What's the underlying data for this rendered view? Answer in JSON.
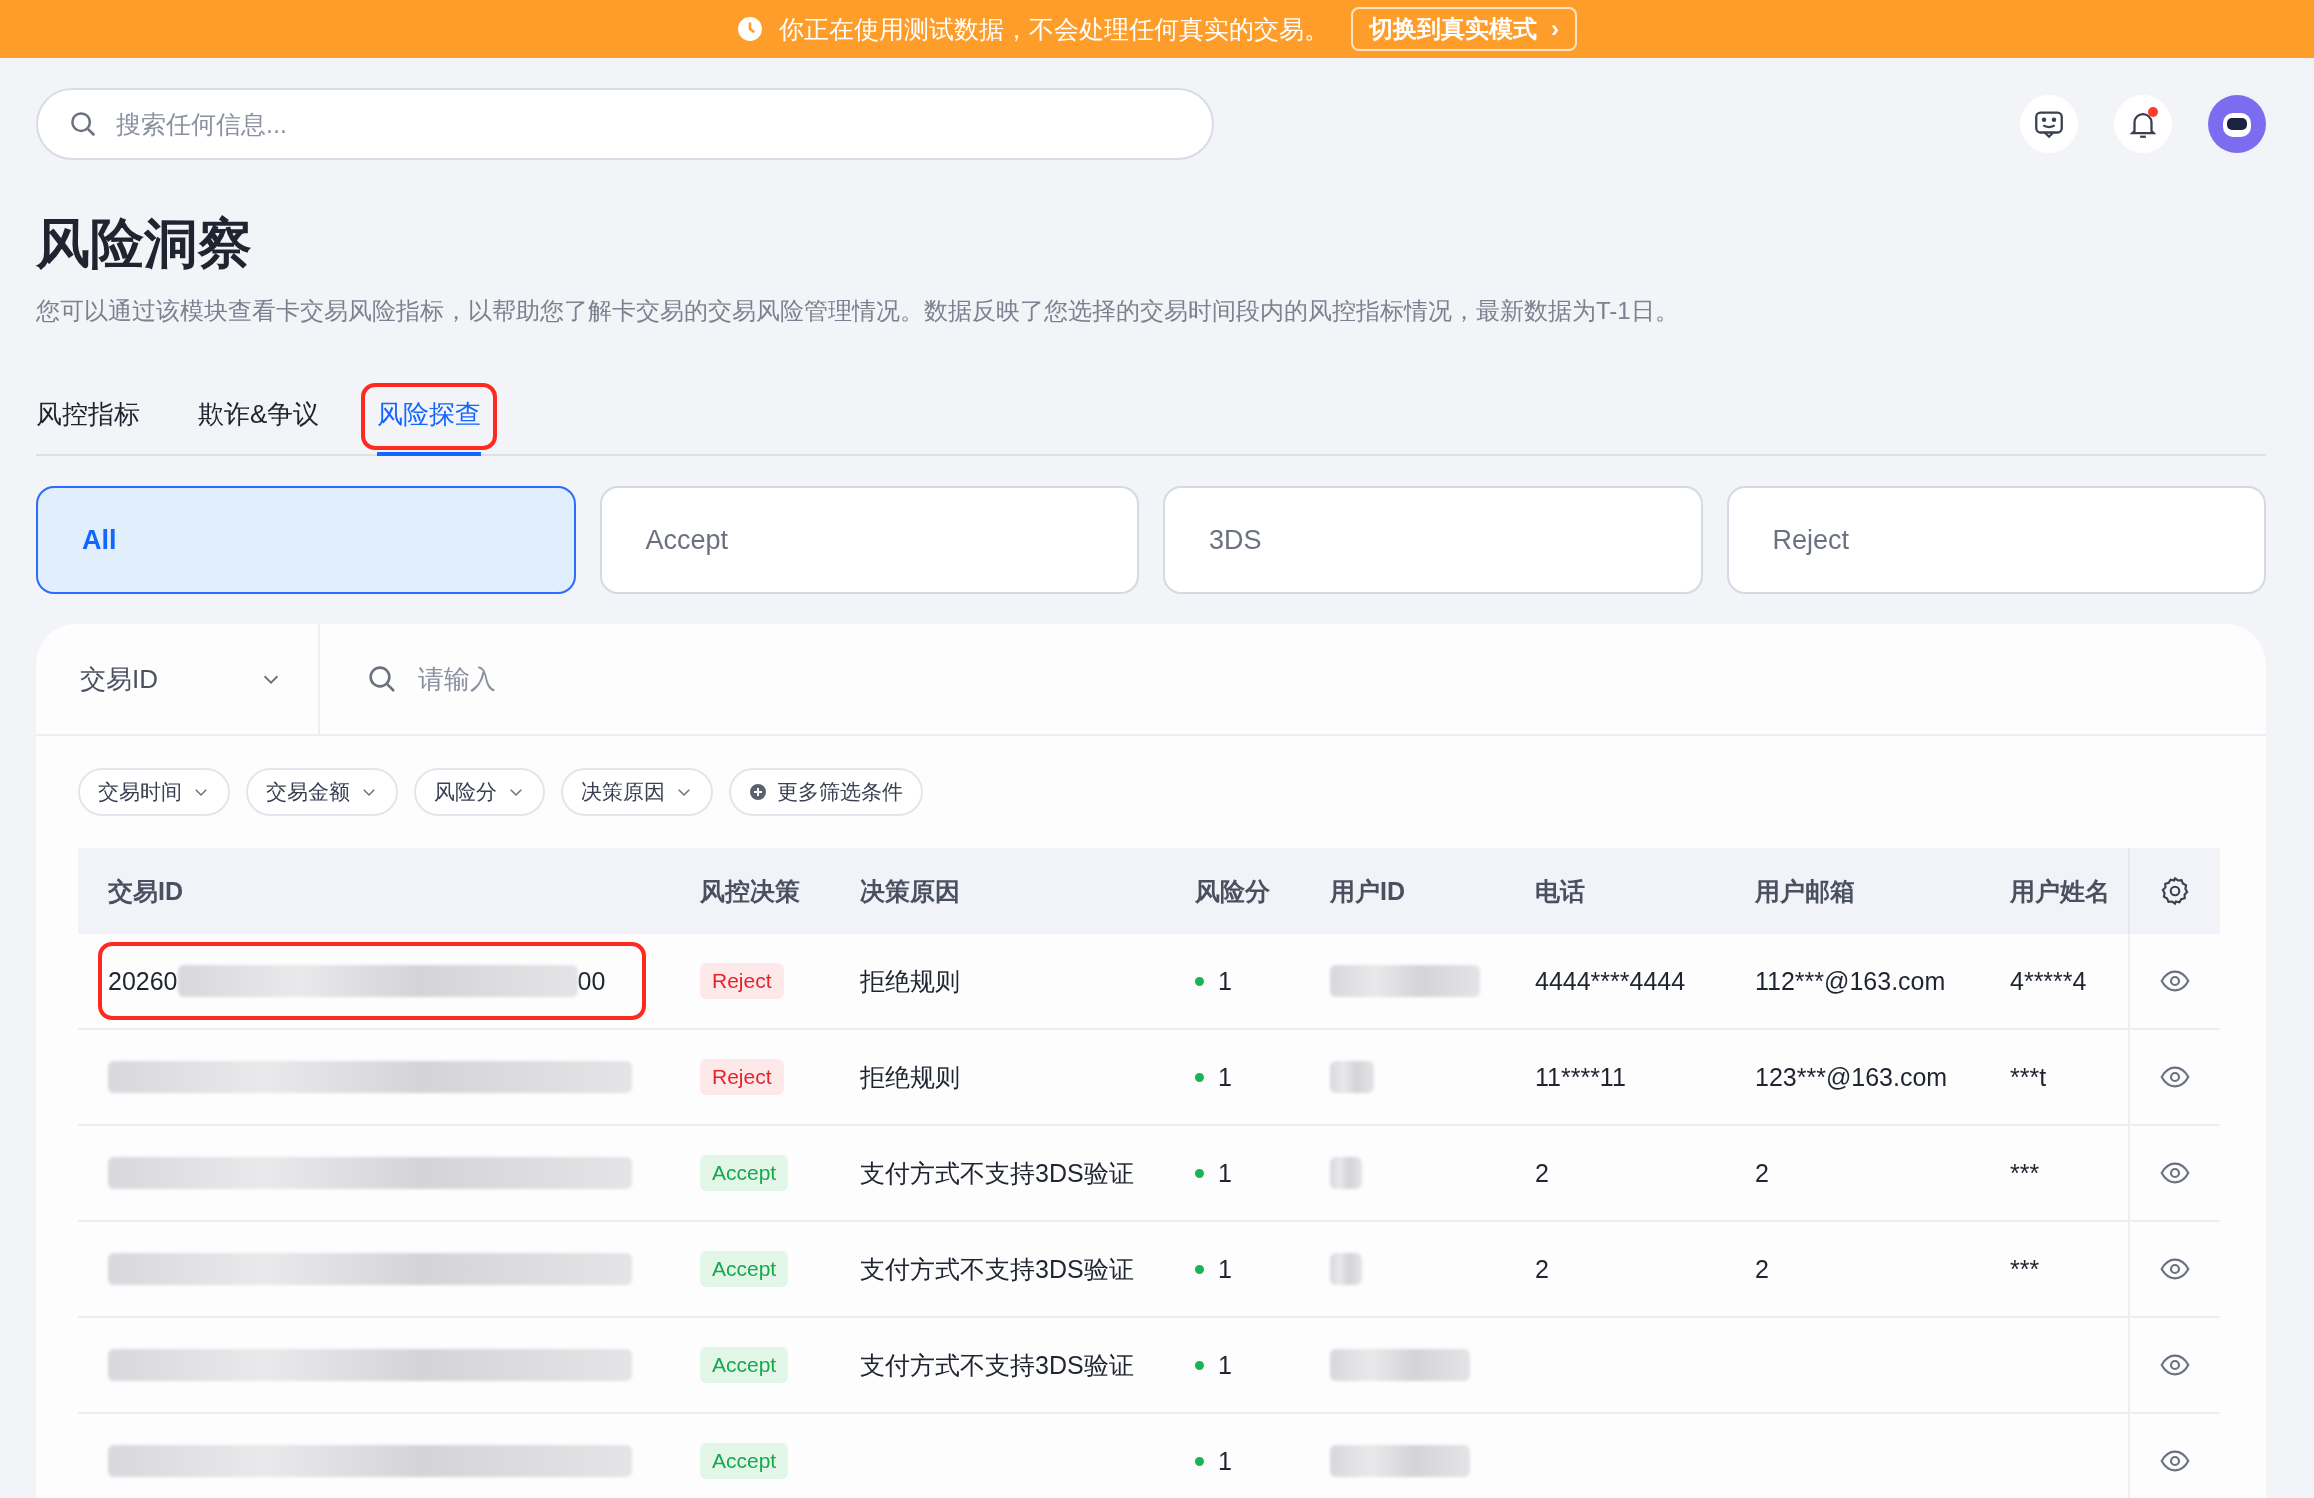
{
  "banner": {
    "message": "你正在使用测试数据，不会处理任何真实的交易。",
    "button": "切换到真实模式",
    "button_icon": "›"
  },
  "header": {
    "search": {
      "placeholder": "搜索任何信息..."
    },
    "notification_dot": true
  },
  "page": {
    "title": "风险洞察",
    "description": "您可以通过该模块查看卡交易风险指标，以帮助您了解卡交易的交易风险管理情况。数据反映了您选择的交易时间段内的风控指标情况，最新数据为T-1日。"
  },
  "tabs": [
    {
      "label": "风控指标",
      "selected": false,
      "highlighted": false
    },
    {
      "label": "欺诈&争议",
      "selected": false,
      "highlighted": false
    },
    {
      "label": "风险探查",
      "selected": true,
      "highlighted": true
    }
  ],
  "decision_cards": [
    {
      "label": "All",
      "selected": true
    },
    {
      "label": "Accept",
      "selected": false
    },
    {
      "label": "3DS",
      "selected": false
    },
    {
      "label": "Reject",
      "selected": false
    }
  ],
  "search": {
    "field_select": "交易ID",
    "placeholder": "请输入"
  },
  "filters": [
    {
      "label": "交易时间",
      "kind": "dropdown"
    },
    {
      "label": "交易金额",
      "kind": "dropdown"
    },
    {
      "label": "风险分",
      "kind": "dropdown"
    },
    {
      "label": "决策原因",
      "kind": "dropdown"
    },
    {
      "label": "更多筛选条件",
      "kind": "add"
    }
  ],
  "table": {
    "columns": [
      "交易ID",
      "风控决策",
      "决策原因",
      "风险分",
      "用户ID",
      "电话",
      "用户邮箱",
      "用户姓名"
    ],
    "rows": [
      {
        "id_start": "20260",
        "id_end": "00",
        "highlighted": true,
        "decision": "Reject",
        "kind": "reject",
        "reason": "拒绝规则",
        "score": "1",
        "phone": "4444****4444",
        "email": "112***@163.com",
        "name": "4*****4"
      },
      {
        "highlighted": false,
        "decision": "Reject",
        "kind": "reject",
        "reason": "拒绝规则",
        "score": "1",
        "phone": "11****11",
        "email": "123***@163.com",
        "name": "***t"
      },
      {
        "highlighted": false,
        "decision": "Accept",
        "kind": "accept",
        "reason": "支付方式不支持3DS验证",
        "score": "1",
        "phone": "2",
        "email": "2",
        "name": "***"
      },
      {
        "highlighted": false,
        "decision": "Accept",
        "kind": "accept",
        "reason": "支付方式不支持3DS验证",
        "score": "1",
        "phone": "2",
        "email": "2",
        "name": "***"
      },
      {
        "highlighted": false,
        "decision": "Accept",
        "kind": "accept",
        "reason": "支付方式不支持3DS验证",
        "score": "1"
      },
      {
        "highlighted": false,
        "decision": "Accept",
        "kind": "accept",
        "score": "1"
      }
    ]
  }
}
